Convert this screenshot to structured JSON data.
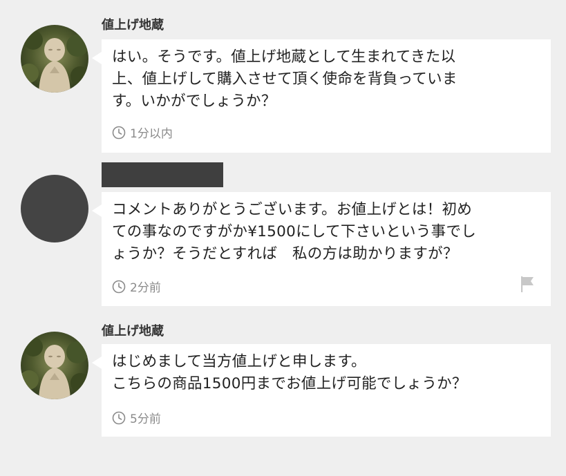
{
  "comments": [
    {
      "author": "値上げ地蔵",
      "text": "はい。そうです。値上げ地蔵として生まれてきた以\n上、値上げして購入させて頂く使命を背負っていま\nす。いかがでしょうか？",
      "time": "1分以内",
      "avatar": "jizo-statue"
    },
    {
      "author": "",
      "text": "コメントありがとうございます。お値上げとは！初め\nての事なのですがか¥1500にして下さいという事でし\nょうか？そうだとすれば　私の方は助かりますが？",
      "time": "2分前",
      "avatar": "redacted",
      "has_flag": true
    },
    {
      "author": "値上げ地蔵",
      "text": "はじめまして当方値上げと申します。\nこちらの商品1500円までお値上げ可能でしょうか？",
      "time": "5分前",
      "avatar": "jizo-statue"
    }
  ],
  "icons": {
    "clock": "clock-icon",
    "flag": "flag-icon"
  },
  "colors": {
    "background": "#efefef",
    "bubble": "#ffffff",
    "meta_text": "#8a8a8a",
    "redacted": "#3f3f3f"
  }
}
